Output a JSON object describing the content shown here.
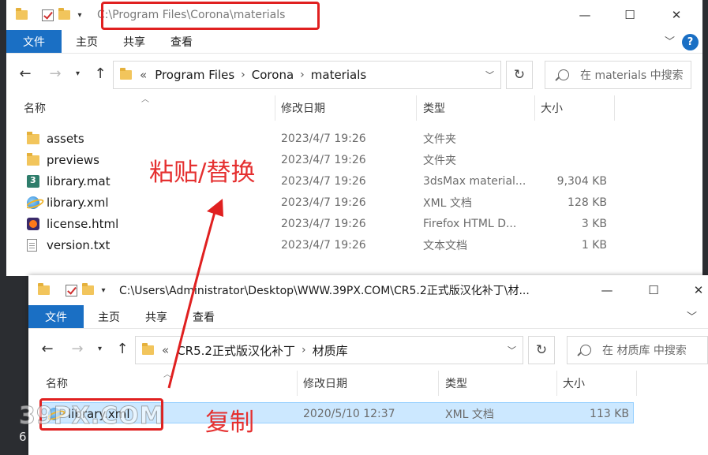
{
  "colors": {
    "accent": "#1a6fc4",
    "annotation": "#e02020",
    "selection": "#cce8ff"
  },
  "win1": {
    "title": "C:\\Program Files\\Corona\\materials",
    "ribbon": {
      "file": "文件",
      "home": "主页",
      "share": "共享",
      "view": "查看"
    },
    "breadcrumb": {
      "overflow": "«",
      "parts": [
        "Program Files",
        "Corona",
        "materials"
      ]
    },
    "search_placeholder": "在 materials 中搜索",
    "columns": {
      "name": "名称",
      "date": "修改日期",
      "type": "类型",
      "size": "大小"
    },
    "files": [
      {
        "name": "assets",
        "date": "2023/4/7 19:26",
        "type": "文件夹",
        "size": "",
        "icon": "folder-icon"
      },
      {
        "name": "previews",
        "date": "2023/4/7 19:26",
        "type": "文件夹",
        "size": "",
        "icon": "folder-icon"
      },
      {
        "name": "library.mat",
        "date": "2023/4/7 19:26",
        "type": "3dsMax material...",
        "size": "9,304 KB",
        "icon": "3dsmax-material-icon"
      },
      {
        "name": "library.xml",
        "date": "2023/4/7 19:26",
        "type": "XML 文档",
        "size": "128 KB",
        "icon": "xml-document-icon"
      },
      {
        "name": "license.html",
        "date": "2023/4/7 19:26",
        "type": "Firefox HTML D...",
        "size": "3 KB",
        "icon": "firefox-html-icon"
      },
      {
        "name": "version.txt",
        "date": "2023/4/7 19:26",
        "type": "文本文档",
        "size": "1 KB",
        "icon": "text-document-icon"
      }
    ]
  },
  "win2": {
    "title": "C:\\Users\\Administrator\\Desktop\\WWW.39PX.COM\\CR5.2正式版汉化补丁\\材...",
    "ribbon": {
      "file": "文件",
      "home": "主页",
      "share": "共享",
      "view": "查看"
    },
    "breadcrumb": {
      "overflow": "«",
      "parts": [
        "CR5.2正式版汉化补丁",
        "材质库"
      ]
    },
    "search_placeholder": "在 材质库 中搜索",
    "columns": {
      "name": "名称",
      "date": "修改日期",
      "type": "类型",
      "size": "大小"
    },
    "files": [
      {
        "name": "library.xml",
        "date": "2020/5/10 12:37",
        "type": "XML 文档",
        "size": "113 KB",
        "icon": "xml-document-icon"
      }
    ]
  },
  "annotations": {
    "paste": "粘贴/替换",
    "copy": "复制"
  },
  "watermark": "39PX.COM",
  "edge_digit": "6"
}
